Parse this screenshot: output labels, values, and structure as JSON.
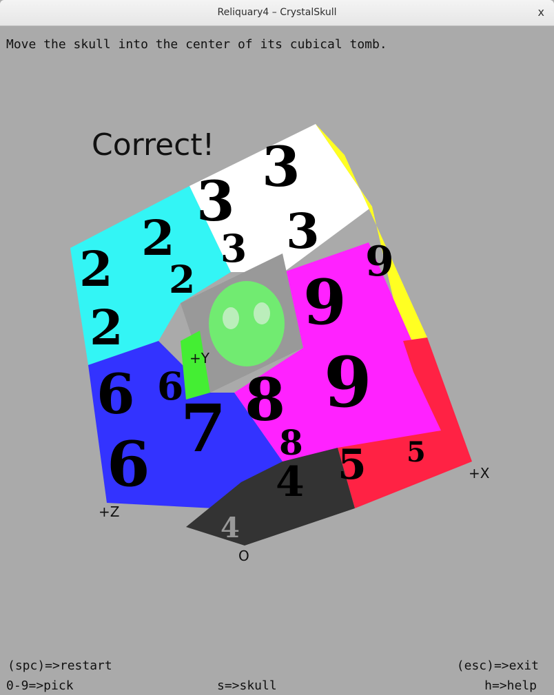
{
  "window": {
    "title": "Reliquary4 – CrystalSkull",
    "close_label": "x"
  },
  "instruction": "Move the skull into the center of its cubical tomb.",
  "status": "Correct!",
  "axes": {
    "y": "+Y",
    "x": "+X",
    "z": "+Z",
    "origin": "O"
  },
  "cube_digits": {
    "cyan": "2",
    "white": "3",
    "yellow": "9",
    "magenta_a": "9",
    "magenta_b": "8",
    "blue_a": "6",
    "blue_b": "7",
    "dark": "4",
    "red": "5"
  },
  "colors": {
    "background": "#aaaaaa",
    "cyan": "#33f5f5",
    "white": "#ffffff",
    "yellow": "#ffff22",
    "magenta": "#ff22ff",
    "blue": "#3333ff",
    "dark": "#333333",
    "red": "#ff2244",
    "hole": "#999999",
    "skull": "#66ff66"
  },
  "help": {
    "restart": "(spc)=>restart",
    "exit": "(esc)=>exit",
    "pick": "0-9=>pick",
    "skull": "s=>skull",
    "help": "h=>help"
  }
}
